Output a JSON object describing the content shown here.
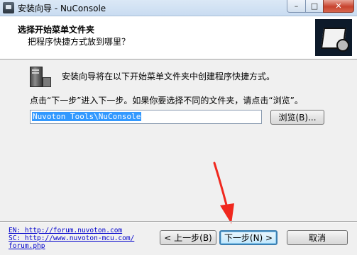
{
  "window": {
    "title": "安装向导 - NuConsole",
    "min_glyph": "–",
    "max_glyph": "□",
    "close_glyph": "✕"
  },
  "header": {
    "title": "选择开始菜单文件夹",
    "subtitle": "把程序快捷方式放到哪里？"
  },
  "body": {
    "info_text": "安装向导将在以下开始菜单文件夹中创建程序快捷方式。",
    "instruction_text": "点击“下一步”进入下一步。如果你要选择不同的文件夹，请点击“浏览”。",
    "folder_value": "Nuvoton Tools\\NuConsole",
    "browse_label": "浏览(B)..."
  },
  "footer": {
    "links": [
      "EN: http://forum.nuvoton.com",
      "SC: http://www.nuvoton-mcu.com/",
      "forum.php"
    ],
    "back_label": "< 上一步(B)",
    "next_label": "下一步(N) >",
    "cancel_label": "取消"
  },
  "colors": {
    "annotation_arrow": "#f0281e",
    "selection": "#3399ff",
    "link": "#0000cc"
  }
}
